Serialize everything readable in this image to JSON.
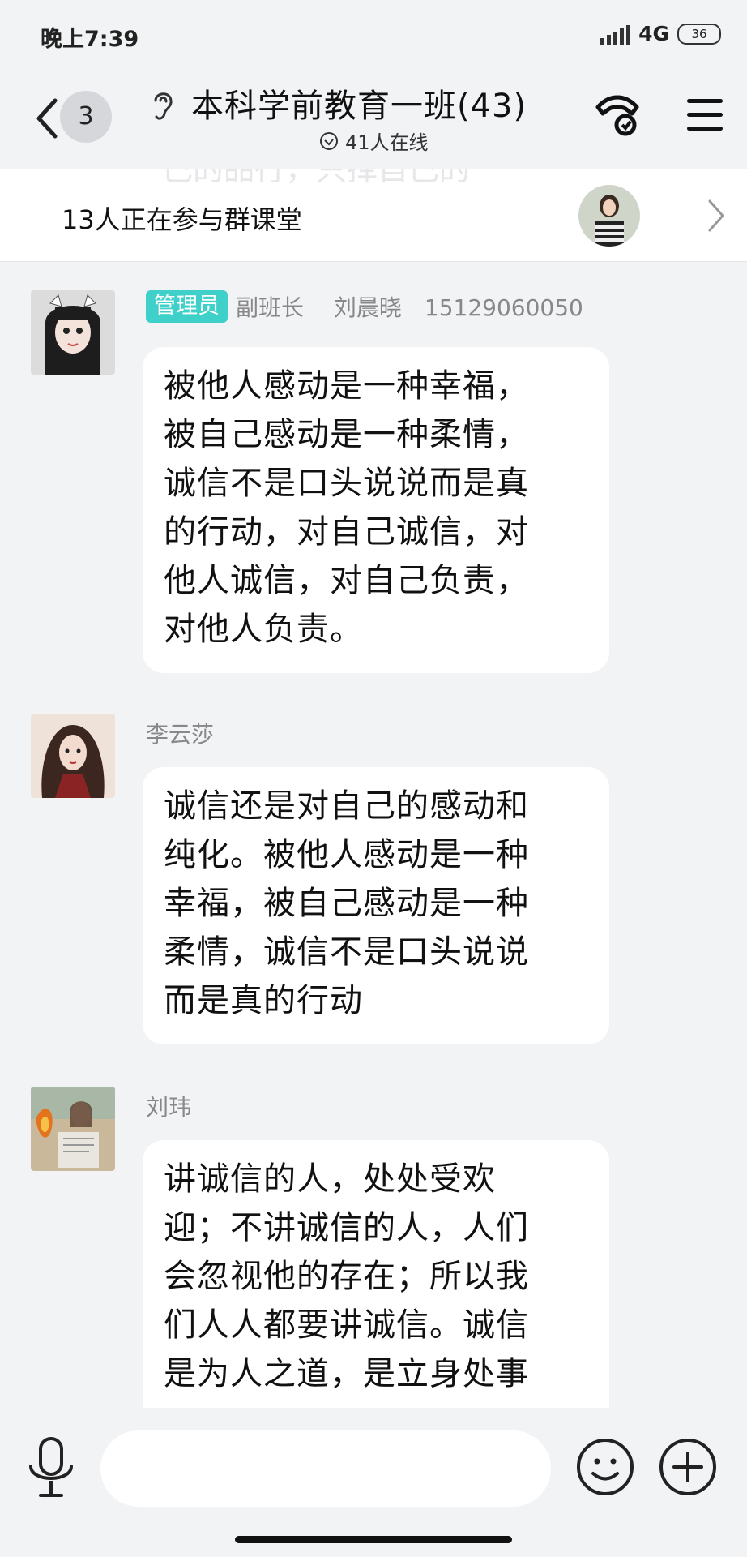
{
  "status_bar": {
    "time": "晚上7:39",
    "network": "4G",
    "battery": "36"
  },
  "header": {
    "back_icon": "chevron-left-icon",
    "unread_count": "3",
    "title": "本科学前教育一班(43)",
    "online_status": "41人在线",
    "call_icon": "phone-call-icon",
    "menu_icon": "hamburger-menu-icon"
  },
  "class_banner": {
    "background_text": "己的品行，只择自己的",
    "text": "13人正在参与群课堂"
  },
  "messages": [
    {
      "badge": "管理员",
      "sender": "副班长　 刘晨晓　15129060050",
      "lines": [
        "被他人感动是一种幸福，",
        "被自己感动是一种柔情，",
        "诚信不是口头说说而是真",
        "的行动，对自己诚信，对",
        "他人诚信，对自己负责，",
        "对他人负责。"
      ]
    },
    {
      "sender": "李云莎",
      "lines": [
        "诚信还是对自己的感动和",
        "纯化。被他人感动是一种",
        "幸福，被自己感动是一种",
        "柔情，诚信不是口头说说",
        "而是真的行动"
      ]
    },
    {
      "sender": "刘玮",
      "lines": [
        "讲诚信的人，处处受欢",
        "迎；不讲诚信的人，人们",
        "会忽视他的存在；所以我",
        "们人人都要讲诚信。诚信",
        "是为人之道，是立身处事"
      ]
    }
  ],
  "input_bar": {
    "placeholder": "",
    "mic_icon": "microphone-icon",
    "emoji_icon": "smiley-icon",
    "plus_icon": "plus-circle-icon"
  },
  "colors": {
    "background": "#f2f3f5",
    "bubble": "#ffffff",
    "admin_badge": "#3fd0c9",
    "sender_name": "#888888"
  }
}
